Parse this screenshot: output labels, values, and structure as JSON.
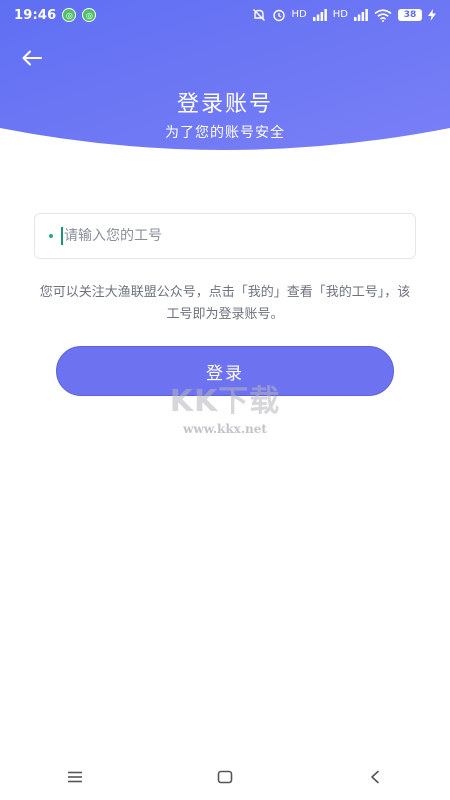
{
  "statusbar": {
    "time": "19:46",
    "battery": "38",
    "network_labels": [
      "HD",
      "HD"
    ],
    "icons": [
      "message-icon",
      "message-icon",
      "mute-icon",
      "alarm-icon",
      "signal-icon",
      "signal-icon",
      "wifi-icon",
      "battery-icon",
      "charging-icon"
    ]
  },
  "header": {
    "back_icon": "arrow-left-icon",
    "title": "登录账号",
    "subtitle": "为了您的账号安全",
    "gradient_start": "#5f6ff3",
    "gradient_end": "#7a7ff6"
  },
  "form": {
    "work_id_placeholder": "请输入您的工号",
    "work_id_value": "",
    "hint": "您可以关注大渔联盟公众号，点击「我的」查看「我的工号」，该工号即为登录账号。",
    "login_label": "登录",
    "accent": "#6d73f0"
  },
  "watermark": {
    "logo": "KK下载",
    "url": "www.kkx.net"
  },
  "navbar": {
    "icons": [
      "menu-icon",
      "home-square-icon",
      "back-chevron-icon"
    ]
  }
}
